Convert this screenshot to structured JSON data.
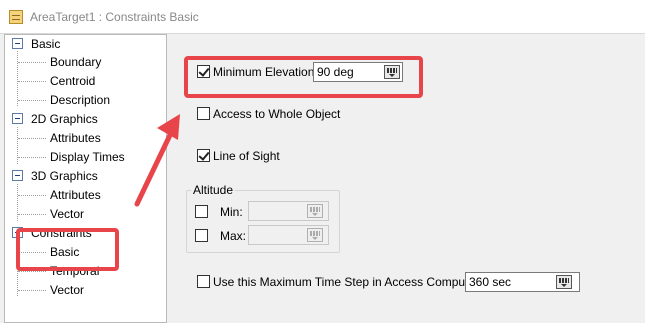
{
  "window": {
    "title": "AreaTarget1 : Constraints Basic"
  },
  "tree": {
    "sections": [
      {
        "label": "Basic",
        "children": [
          "Boundary",
          "Centroid",
          "Description"
        ]
      },
      {
        "label": "2D Graphics",
        "children": [
          "Attributes",
          "Display Times"
        ]
      },
      {
        "label": "3D Graphics",
        "children": [
          "Attributes",
          "Vector"
        ]
      },
      {
        "label": "Constraints",
        "children": [
          "Basic",
          "Temporal",
          "Vector"
        ]
      }
    ]
  },
  "panel": {
    "min_elevation": {
      "label": "Minimum Elevation:",
      "value": "90 deg",
      "checked": true
    },
    "whole_object": {
      "label": "Access to Whole Object",
      "checked": false
    },
    "line_of_sight": {
      "label": "Line of Sight",
      "checked": true
    },
    "altitude": {
      "title": "Altitude",
      "min_label": "Min:",
      "max_label": "Max:",
      "min_value": "",
      "max_value": ""
    },
    "max_time_step": {
      "label": "Use this Maximum Time Step in Access Computations",
      "value": "360 sec",
      "checked": false
    }
  },
  "colors": {
    "highlight": "#e8454b",
    "tree_background": "#ffffff",
    "panel_background": "#f0f0f0"
  },
  "icons": {
    "title_icon": "notepad-icon",
    "unit_button": "units-dropdown-icon",
    "expander": "minus-expander-icon"
  }
}
